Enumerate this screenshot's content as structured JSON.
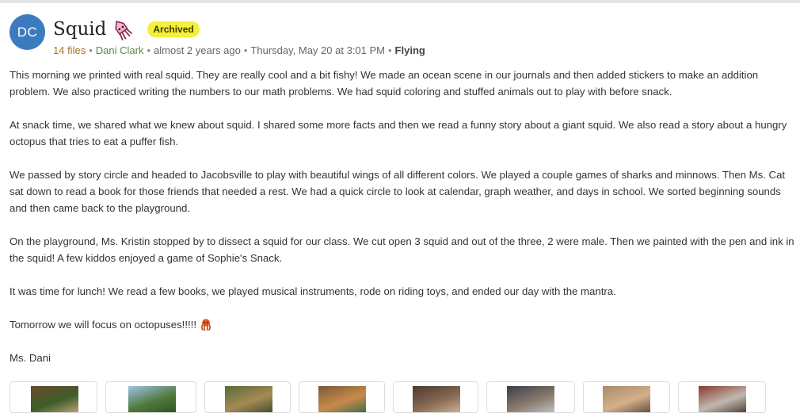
{
  "post": {
    "avatar_initials": "DC",
    "title": "Squid",
    "title_emoji": "squid-icon",
    "badge": "Archived",
    "meta": {
      "files": "14 files",
      "author": "Dani Clark",
      "relative_time": "almost 2 years ago",
      "date": "Thursday, May 20 at 3:01 PM",
      "group": "Flying",
      "separator": "•"
    },
    "paragraphs": [
      "This morning we printed with real squid. They are really cool and a bit fishy! We made an ocean scene in our journals and then added stickers to make an addition problem. We also practiced writing the numbers to our math problems. We had squid coloring and stuffed animals out to play with before snack.",
      "At snack time, we shared what we knew about squid. I shared some more facts and then we read a funny story about a giant squid. We also read a story about a hungry octopus that tries to eat a puffer fish.",
      "We passed by story circle and headed to Jacobsville to play with beautiful wings of all different colors. We played a couple games of sharks and minnows. Then Ms. Cat sat down to read a book for those friends that needed a rest. We had a quick circle to look at calendar, graph weather, and days in school. We sorted beginning sounds and then came back to the playground.",
      "On the playground, Ms. Kristin stopped by to dissect a squid for our class. We cut open 3 squid and out of the three, 2 were male. Then we painted with the pen and ink in the squid! A few kiddos enjoyed a game of Sophie's Snack.",
      "It was time for lunch! We read a few books, we played musical instruments, rode on riding toys, and ended our day with the mantra.",
      "Tomorrow we will focus on octopuses!!!!!",
      "Ms. Dani"
    ],
    "octopus_emoji": "octopus-icon"
  },
  "thumbnails": [
    {
      "name": "photo-1",
      "colors": [
        "#6b4a2f",
        "#3e5d2a",
        "#c9a27a"
      ]
    },
    {
      "name": "photo-2",
      "colors": [
        "#9fc2e6",
        "#4f7a3a",
        "#2f4f24"
      ]
    },
    {
      "name": "photo-3",
      "colors": [
        "#5a6b3a",
        "#a58a55",
        "#3e4a28"
      ]
    },
    {
      "name": "photo-4",
      "colors": [
        "#7a5a3a",
        "#c98a4a",
        "#3a6a4a"
      ]
    },
    {
      "name": "photo-5",
      "colors": [
        "#4a3a2e",
        "#8a6a52",
        "#d0b89a"
      ]
    },
    {
      "name": "photo-6",
      "colors": [
        "#3a3e4a",
        "#8a7a6a",
        "#c0c8d0"
      ]
    },
    {
      "name": "photo-7",
      "colors": [
        "#a98a6a",
        "#d4b08a",
        "#5a4a3a"
      ]
    },
    {
      "name": "photo-8",
      "colors": [
        "#8a3a2a",
        "#c0b8b0",
        "#4a3a30"
      ]
    }
  ]
}
